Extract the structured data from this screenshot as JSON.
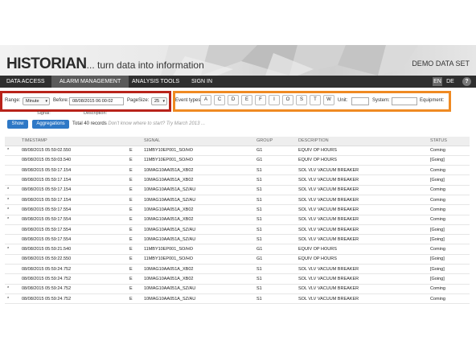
{
  "header": {
    "title": "HISTORIAN",
    "tagline": "... turn data into information",
    "dataset": "DEMO DATA SET"
  },
  "nav": {
    "tabs": [
      {
        "label": "DATA ACCESS"
      },
      {
        "label": "ALARM MANAGEMENT"
      },
      {
        "label": "ANALYSIS TOOLS"
      },
      {
        "label": "SIGN IN"
      }
    ],
    "active_tab": "ALARM MANAGEMENT",
    "languages": [
      "EN",
      "DE"
    ],
    "active_language": "EN",
    "help": "?"
  },
  "filters": {
    "range_label": "Range:",
    "range_value": "Minute",
    "before_label": "Before:",
    "before_value": "08/08/2015 06:00:02",
    "pagesize_label": "PageSize:",
    "pagesize_value": "25",
    "signal_label": "Signal:",
    "description_label": "Description:",
    "event_types_label": "Event types:",
    "event_types": [
      "A",
      "C",
      "D",
      "E",
      "F",
      "I",
      "O",
      "S",
      "T",
      "W"
    ],
    "unit_label": "Unit:",
    "unit_value": "",
    "system_label": "System:",
    "system_value": "",
    "equipment_label": "Equipment:",
    "equipment_value": ""
  },
  "actions": {
    "show_label": "Show",
    "aggregations_label": "Aggregations",
    "records_text": "Total 40 records",
    "hint_text": "Don't know where to start? Try March 2013 ..."
  },
  "highlight_colors": {
    "range_box": "#b8231a",
    "events_box": "#ef8a22",
    "button": "#2e78c6"
  },
  "table": {
    "columns": [
      "",
      "TIMESTAMP",
      "",
      "SIGNAL",
      "GROUP",
      "DESCRIPTION",
      "STATUS"
    ],
    "rows": [
      [
        "*",
        "08/08/2015 05:59:02.550",
        "E",
        "11MBY10EP001_SO/HO",
        "G1",
        "EQUIV OP HOURS",
        "Coming"
      ],
      [
        "",
        "08/08/2015 05:59:03.540",
        "E",
        "11MBY10EP001_SO/HO",
        "G1",
        "EQUIV OP HOURS",
        "[Going]"
      ],
      [
        "",
        "08/08/2015 05:59:17.154",
        "E",
        "10MAG10AA051A_XB02",
        "S1",
        "SOL VLV VACUUM BREAKER",
        "Coming"
      ],
      [
        "",
        "08/08/2015 05:59:17.154",
        "E",
        "10MAG10AA051A_XB02",
        "S1",
        "SOL VLV VACUUM BREAKER",
        "[Going]"
      ],
      [
        "*",
        "08/08/2015 05:59:17.154",
        "E",
        "10MAG10AA051A_SZ/AU",
        "S1",
        "SOL VLV VACUUM BREAKER",
        "Coming"
      ],
      [
        "*",
        "08/08/2015 05:59:17.154",
        "E",
        "10MAG10AA051A_SZ/AU",
        "S1",
        "SOL VLV VACUUM BREAKER",
        "Coming"
      ],
      [
        "*",
        "08/08/2015 05:59:17.554",
        "E",
        "10MAG10AA051A_XB02",
        "S1",
        "SOL VLV VACUUM BREAKER",
        "Coming"
      ],
      [
        "*",
        "08/08/2015 05:59:17.554",
        "E",
        "10MAG10AA051A_XB02",
        "S1",
        "SOL VLV VACUUM BREAKER",
        "Coming"
      ],
      [
        "",
        "08/08/2015 05:59:17.554",
        "E",
        "10MAG10AA051A_SZ/AU",
        "S1",
        "SOL VLV VACUUM BREAKER",
        "[Going]"
      ],
      [
        "",
        "08/08/2015 05:59:17.554",
        "E",
        "10MAG10AA051A_SZ/AU",
        "S1",
        "SOL VLV VACUUM BREAKER",
        "[Going]"
      ],
      [
        "*",
        "08/08/2015 05:59:21.540",
        "E",
        "11MBY10EP001_SO/HO",
        "G1",
        "EQUIV OP HOURS",
        "Coming"
      ],
      [
        "",
        "08/08/2015 05:59:22.550",
        "E",
        "11MBY10EP001_SO/HO",
        "G1",
        "EQUIV OP HOURS",
        "[Going]"
      ],
      [
        "",
        "08/08/2015 05:59:24.752",
        "E",
        "10MAG10AA051A_XB02",
        "S1",
        "SOL VLV VACUUM BREAKER",
        "[Going]"
      ],
      [
        "",
        "08/08/2015 05:59:24.752",
        "E",
        "10MAG10AA051A_XB02",
        "S1",
        "SOL VLV VACUUM BREAKER",
        "[Going]"
      ],
      [
        "*",
        "08/08/2015 05:59:24.752",
        "E",
        "10MAG10AA051A_SZ/AU",
        "S1",
        "SOL VLV VACUUM BREAKER",
        "Coming"
      ],
      [
        "*",
        "08/08/2015 05:59:24.752",
        "E",
        "10MAG10AA051A_SZ/AU",
        "S1",
        "SOL VLV VACUUM BREAKER",
        "Coming"
      ]
    ]
  }
}
